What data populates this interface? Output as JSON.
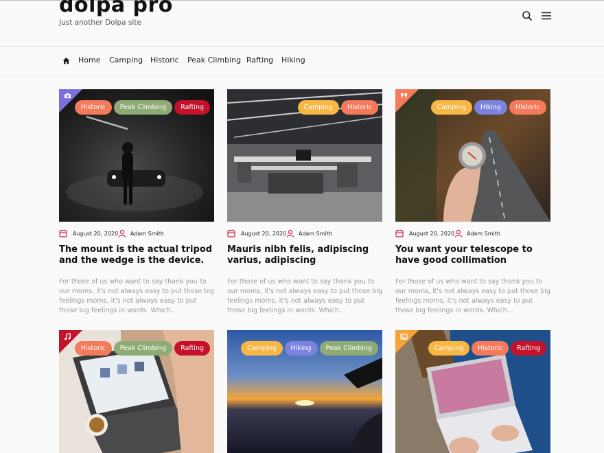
{
  "site": {
    "title": "dolpa pro",
    "tagline": "Just another Dolpa site"
  },
  "header": {
    "search_icon": "search-icon",
    "menu_icon": "hamburger-menu-icon"
  },
  "nav": {
    "home_icon": "home-icon",
    "items": [
      {
        "label": "Home"
      },
      {
        "label": "Camping"
      },
      {
        "label": "Historic"
      },
      {
        "label": "Peak Climbing"
      },
      {
        "label": "Rafting"
      },
      {
        "label": "Hiking"
      }
    ]
  },
  "colors": {
    "Historic": "#f47a5b",
    "Peak Climbing": "#8fab75",
    "Rafting": "#c4122b",
    "Camping": "#f6b745",
    "Hiking": "#7b82e0"
  },
  "posts": [
    {
      "format_icon": "camera-icon",
      "corner_color": "#7b6fdc",
      "tags": [
        "Historic",
        "Peak Climbing",
        "Rafting"
      ],
      "date": "August 20, 2020",
      "author": "Adam Smith",
      "title": "The mount is the actual tripod and the wedge is the device.",
      "excerpt": "For those of us who want to say thank you to our moms, it's not always easy to put those big feelings moms, it's not always easy to put those big feelings in words. Which…"
    },
    {
      "format_icon": "",
      "corner_color": "",
      "tags": [
        "Camping",
        "Historic"
      ],
      "date": "August 20, 2020",
      "author": "Adam Smith",
      "title": "Mauris nibh felis, adipiscing varius, adipiscing",
      "excerpt": "For those of us who want to say thank you to our moms, it's not always easy to put those big feelings moms, it's not always easy to put those big feelings in words. Which…"
    },
    {
      "format_icon": "quote-icon",
      "corner_color": "#f47a5b",
      "tags": [
        "Camping",
        "Hiking",
        "Historic"
      ],
      "date": "August 20, 2020",
      "author": "Adam Smith",
      "title": "You want your telescope to have good collimation",
      "excerpt": "For those of us who want to say thank you to our moms, it's not always easy to put those big feelings moms, it's not always easy to put those big feelings in words. Which…"
    },
    {
      "format_icon": "music-icon",
      "corner_color": "#c4122b",
      "tags": [
        "Historic",
        "Peak Climbing",
        "Rafting"
      ]
    },
    {
      "format_icon": "",
      "corner_color": "",
      "tags": [
        "Camping",
        "Hiking",
        "Peak Climbing"
      ]
    },
    {
      "format_icon": "image-icon",
      "corner_color": "#f6a33a",
      "tags": [
        "Camping",
        "Historic",
        "Rafting"
      ]
    }
  ]
}
